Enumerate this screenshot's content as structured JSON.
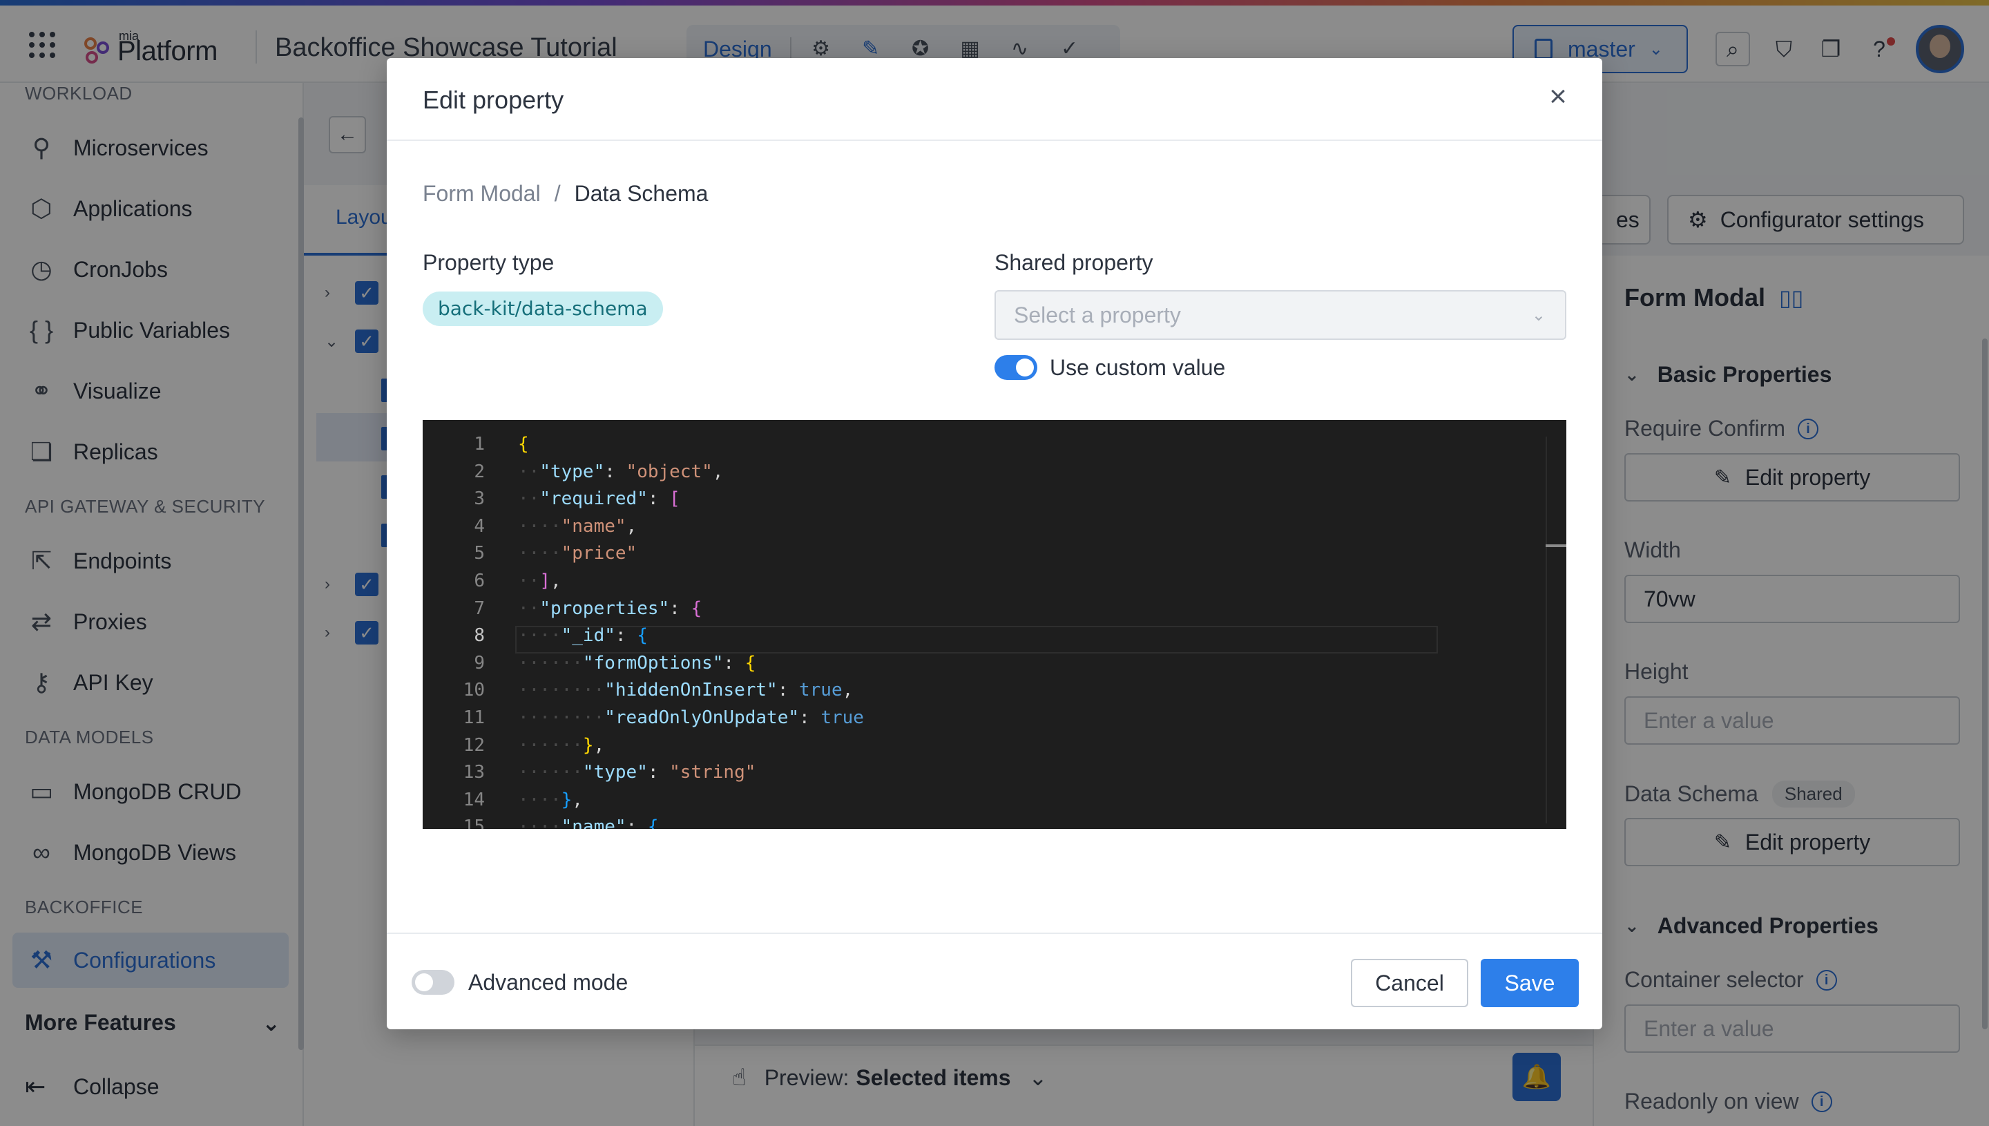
{
  "topbar": {
    "logo_small": "mia",
    "logo_text": "Platform",
    "project_title": "Backoffice Showcase Tutorial",
    "design_label": "Design",
    "branch": "master",
    "colors": {
      "accent": "#2d6fd6",
      "primary_button": "#2d7fea"
    }
  },
  "sidebar": {
    "sections": {
      "workload": "WORKLOAD",
      "api_gateway": "API GATEWAY & SECURITY",
      "data_models": "DATA MODELS",
      "backoffice": "BACKOFFICE"
    },
    "items": {
      "microservices": "Microservices",
      "applications": "Applications",
      "cronjobs": "CronJobs",
      "public_variables": "Public Variables",
      "visualize": "Visualize",
      "replicas": "Replicas",
      "endpoints": "Endpoints",
      "proxies": "Proxies",
      "api_key": "API Key",
      "mongodb_crud": "MongoDB CRUD",
      "mongodb_views": "MongoDB Views",
      "configurations": "Configurations"
    },
    "more_features": "More Features",
    "collapse": "Collapse"
  },
  "center": {
    "layout_tab": "Layou",
    "preview_label": "Preview:",
    "preview_value": "Selected items"
  },
  "right_panel": {
    "top_button_partial": "es",
    "configurator_settings": "Configurator settings",
    "title": "Form Modal",
    "basic_properties": "Basic Properties",
    "require_confirm": "Require Confirm",
    "edit_property": "Edit property",
    "width_label": "Width",
    "width_value": "70vw",
    "height_label": "Height",
    "height_placeholder": "Enter a value",
    "data_schema_label": "Data Schema",
    "shared_badge": "Shared",
    "advanced_properties": "Advanced Properties",
    "container_selector": "Container selector",
    "container_placeholder": "Enter a value",
    "readonly_on_view": "Readonly on view"
  },
  "modal": {
    "title": "Edit property",
    "breadcrumb": {
      "parent": "Form Modal",
      "separator": "/",
      "current": "Data Schema"
    },
    "property_type_label": "Property type",
    "property_type_value": "back-kit/data-schema",
    "shared_property_label": "Shared property",
    "shared_property_placeholder": "Select a property",
    "use_custom_value": "Use custom value",
    "use_custom_value_on": true,
    "advanced_mode": "Advanced mode",
    "advanced_mode_on": false,
    "cancel": "Cancel",
    "save": "Save",
    "editor": {
      "current_line": 8,
      "line_numbers": [
        "1",
        "2",
        "3",
        "4",
        "5",
        "6",
        "7",
        "8",
        "9",
        "10",
        "11",
        "12",
        "13",
        "14",
        "15"
      ],
      "lines": [
        [
          {
            "t": "{",
            "c": "t-brace"
          }
        ],
        [
          {
            "t": "··",
            "c": "guide"
          },
          {
            "t": "\"type\"",
            "c": "t-key"
          },
          {
            "t": ": ",
            "c": "t-punc"
          },
          {
            "t": "\"object\"",
            "c": "t-str"
          },
          {
            "t": ",",
            "c": "t-punc"
          }
        ],
        [
          {
            "t": "··",
            "c": "guide"
          },
          {
            "t": "\"required\"",
            "c": "t-key"
          },
          {
            "t": ": ",
            "c": "t-punc"
          },
          {
            "t": "[",
            "c": "t-bracket"
          }
        ],
        [
          {
            "t": "····",
            "c": "guide"
          },
          {
            "t": "\"name\"",
            "c": "t-str"
          },
          {
            "t": ",",
            "c": "t-punc"
          }
        ],
        [
          {
            "t": "····",
            "c": "guide"
          },
          {
            "t": "\"price\"",
            "c": "t-str"
          }
        ],
        [
          {
            "t": "··",
            "c": "guide"
          },
          {
            "t": "]",
            "c": "t-bracket"
          },
          {
            "t": ",",
            "c": "t-punc"
          }
        ],
        [
          {
            "t": "··",
            "c": "guide"
          },
          {
            "t": "\"properties\"",
            "c": "t-key"
          },
          {
            "t": ": ",
            "c": "t-punc"
          },
          {
            "t": "{",
            "c": "t-bracket"
          }
        ],
        [
          {
            "t": "····",
            "c": "guide"
          },
          {
            "t": "\"_id\"",
            "c": "t-key"
          },
          {
            "t": ": ",
            "c": "t-punc"
          },
          {
            "t": "{",
            "c": "t-brace2"
          }
        ],
        [
          {
            "t": "······",
            "c": "guide"
          },
          {
            "t": "\"formOptions\"",
            "c": "t-key"
          },
          {
            "t": ": ",
            "c": "t-punc"
          },
          {
            "t": "{",
            "c": "t-brace"
          }
        ],
        [
          {
            "t": "········",
            "c": "guide"
          },
          {
            "t": "\"hiddenOnInsert\"",
            "c": "t-key"
          },
          {
            "t": ": ",
            "c": "t-punc"
          },
          {
            "t": "true",
            "c": "t-bool"
          },
          {
            "t": ",",
            "c": "t-punc"
          }
        ],
        [
          {
            "t": "········",
            "c": "guide"
          },
          {
            "t": "\"readOnlyOnUpdate\"",
            "c": "t-key"
          },
          {
            "t": ": ",
            "c": "t-punc"
          },
          {
            "t": "true",
            "c": "t-bool"
          }
        ],
        [
          {
            "t": "······",
            "c": "guide"
          },
          {
            "t": "}",
            "c": "t-brace"
          },
          {
            "t": ",",
            "c": "t-punc"
          }
        ],
        [
          {
            "t": "······",
            "c": "guide"
          },
          {
            "t": "\"type\"",
            "c": "t-key"
          },
          {
            "t": ": ",
            "c": "t-punc"
          },
          {
            "t": "\"string\"",
            "c": "t-str"
          }
        ],
        [
          {
            "t": "····",
            "c": "guide"
          },
          {
            "t": "}",
            "c": "t-brace2"
          },
          {
            "t": ",",
            "c": "t-punc"
          }
        ],
        [
          {
            "t": "····",
            "c": "guide"
          },
          {
            "t": "\"name\"",
            "c": "t-key"
          },
          {
            "t": ": ",
            "c": "t-punc"
          },
          {
            "t": "{",
            "c": "t-brace2"
          }
        ]
      ]
    }
  }
}
